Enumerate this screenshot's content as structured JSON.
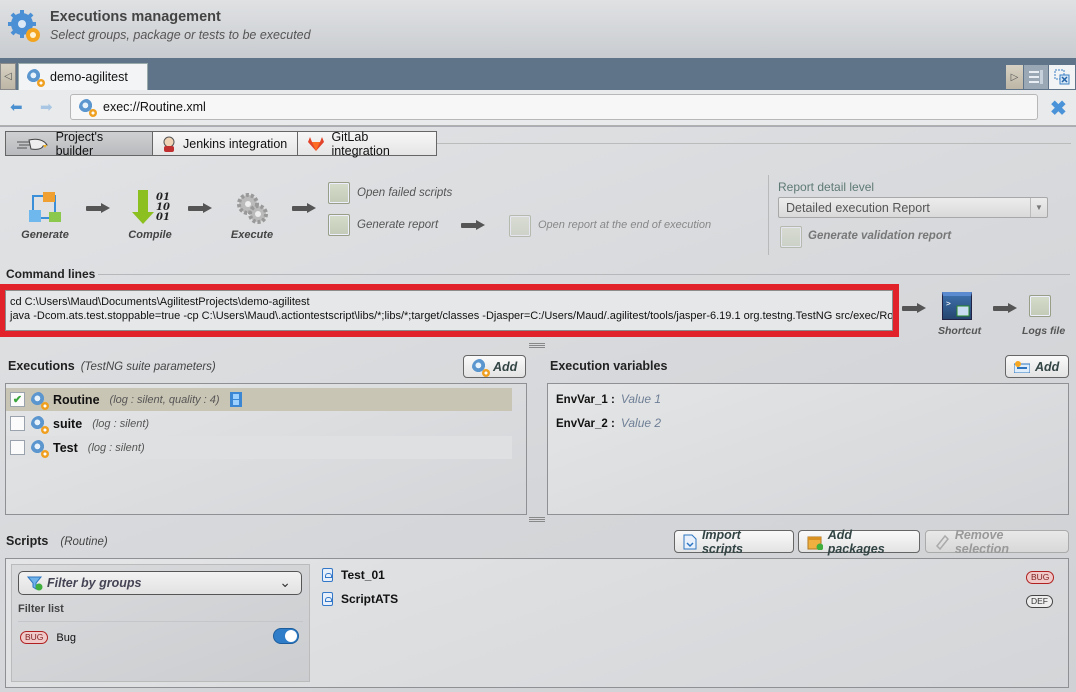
{
  "header": {
    "title": "Executions management",
    "subtitle": "Select groups, package or tests to be executed"
  },
  "tabs": [
    {
      "label": "demo-agilitest",
      "active": true
    }
  ],
  "address": {
    "value": "exec://Routine.xml"
  },
  "subtabs": [
    {
      "label": "Project's builder",
      "active": true
    },
    {
      "label": "Jenkins integration",
      "active": false
    },
    {
      "label": "GitLab integration",
      "active": false
    }
  ],
  "pipeline": {
    "steps": [
      "Generate",
      "Compile",
      "Execute"
    ],
    "options": {
      "open_failed": {
        "label": "Open failed scripts",
        "checked": false
      },
      "generate_report": {
        "label": "Generate report",
        "checked": false
      },
      "open_report": {
        "label": "Open  report at the end of execution",
        "checked": false,
        "enabled": false
      }
    },
    "report": {
      "title": "Report detail level",
      "selected": "Detailed execution Report",
      "validation_label": "Generate validation report",
      "validation_checked": false
    }
  },
  "command": {
    "title": "Command lines",
    "line1": "cd C:\\Users\\Maud\\Documents\\AgilitestProjects\\demo-agilitest",
    "line2": "java -Dcom.ats.test.stoppable=true -cp C:\\Users\\Maud\\.actiontestscript\\libs/*;libs/*;target/classes -Djasper=C:/Users/Maud/.agilitest/tools/jasper-6.19.1 org.testng.TestNG src/exec/Rout",
    "shortcut_label": "Shortcut",
    "logs_label": "Logs file",
    "highlight_color": "#e2222a"
  },
  "executions": {
    "title": "Executions",
    "subtitle": "(TestNG suite parameters)",
    "add_label": "Add",
    "items": [
      {
        "name": "Routine",
        "info": "(log : silent, quality : 4)",
        "checked": true,
        "selected": true,
        "has_video": true
      },
      {
        "name": "suite",
        "info": "(log : silent)",
        "checked": false,
        "selected": false
      },
      {
        "name": "Test",
        "info": "(log : silent)",
        "checked": false,
        "selected": false
      }
    ]
  },
  "variables": {
    "title": "Execution variables",
    "add_label": "Add",
    "items": [
      {
        "name": "EnvVar_1 :",
        "value": "Value 1"
      },
      {
        "name": "EnvVar_2 :",
        "value": "Value 2"
      }
    ]
  },
  "scripts": {
    "title": "Scripts",
    "subtitle": "(Routine)",
    "import_label": "Import scripts",
    "add_packages_label": "Add packages",
    "remove_label": "Remove selection",
    "filter_placeholder": "Filter by groups",
    "filter_list_title": "Filter list",
    "filters": [
      {
        "tag": "BUG",
        "label": "Bug",
        "enabled": true
      }
    ],
    "items": [
      {
        "name": "Test_01",
        "tag": "BUG"
      },
      {
        "name": "ScriptATS",
        "tag": "DEF"
      }
    ]
  }
}
